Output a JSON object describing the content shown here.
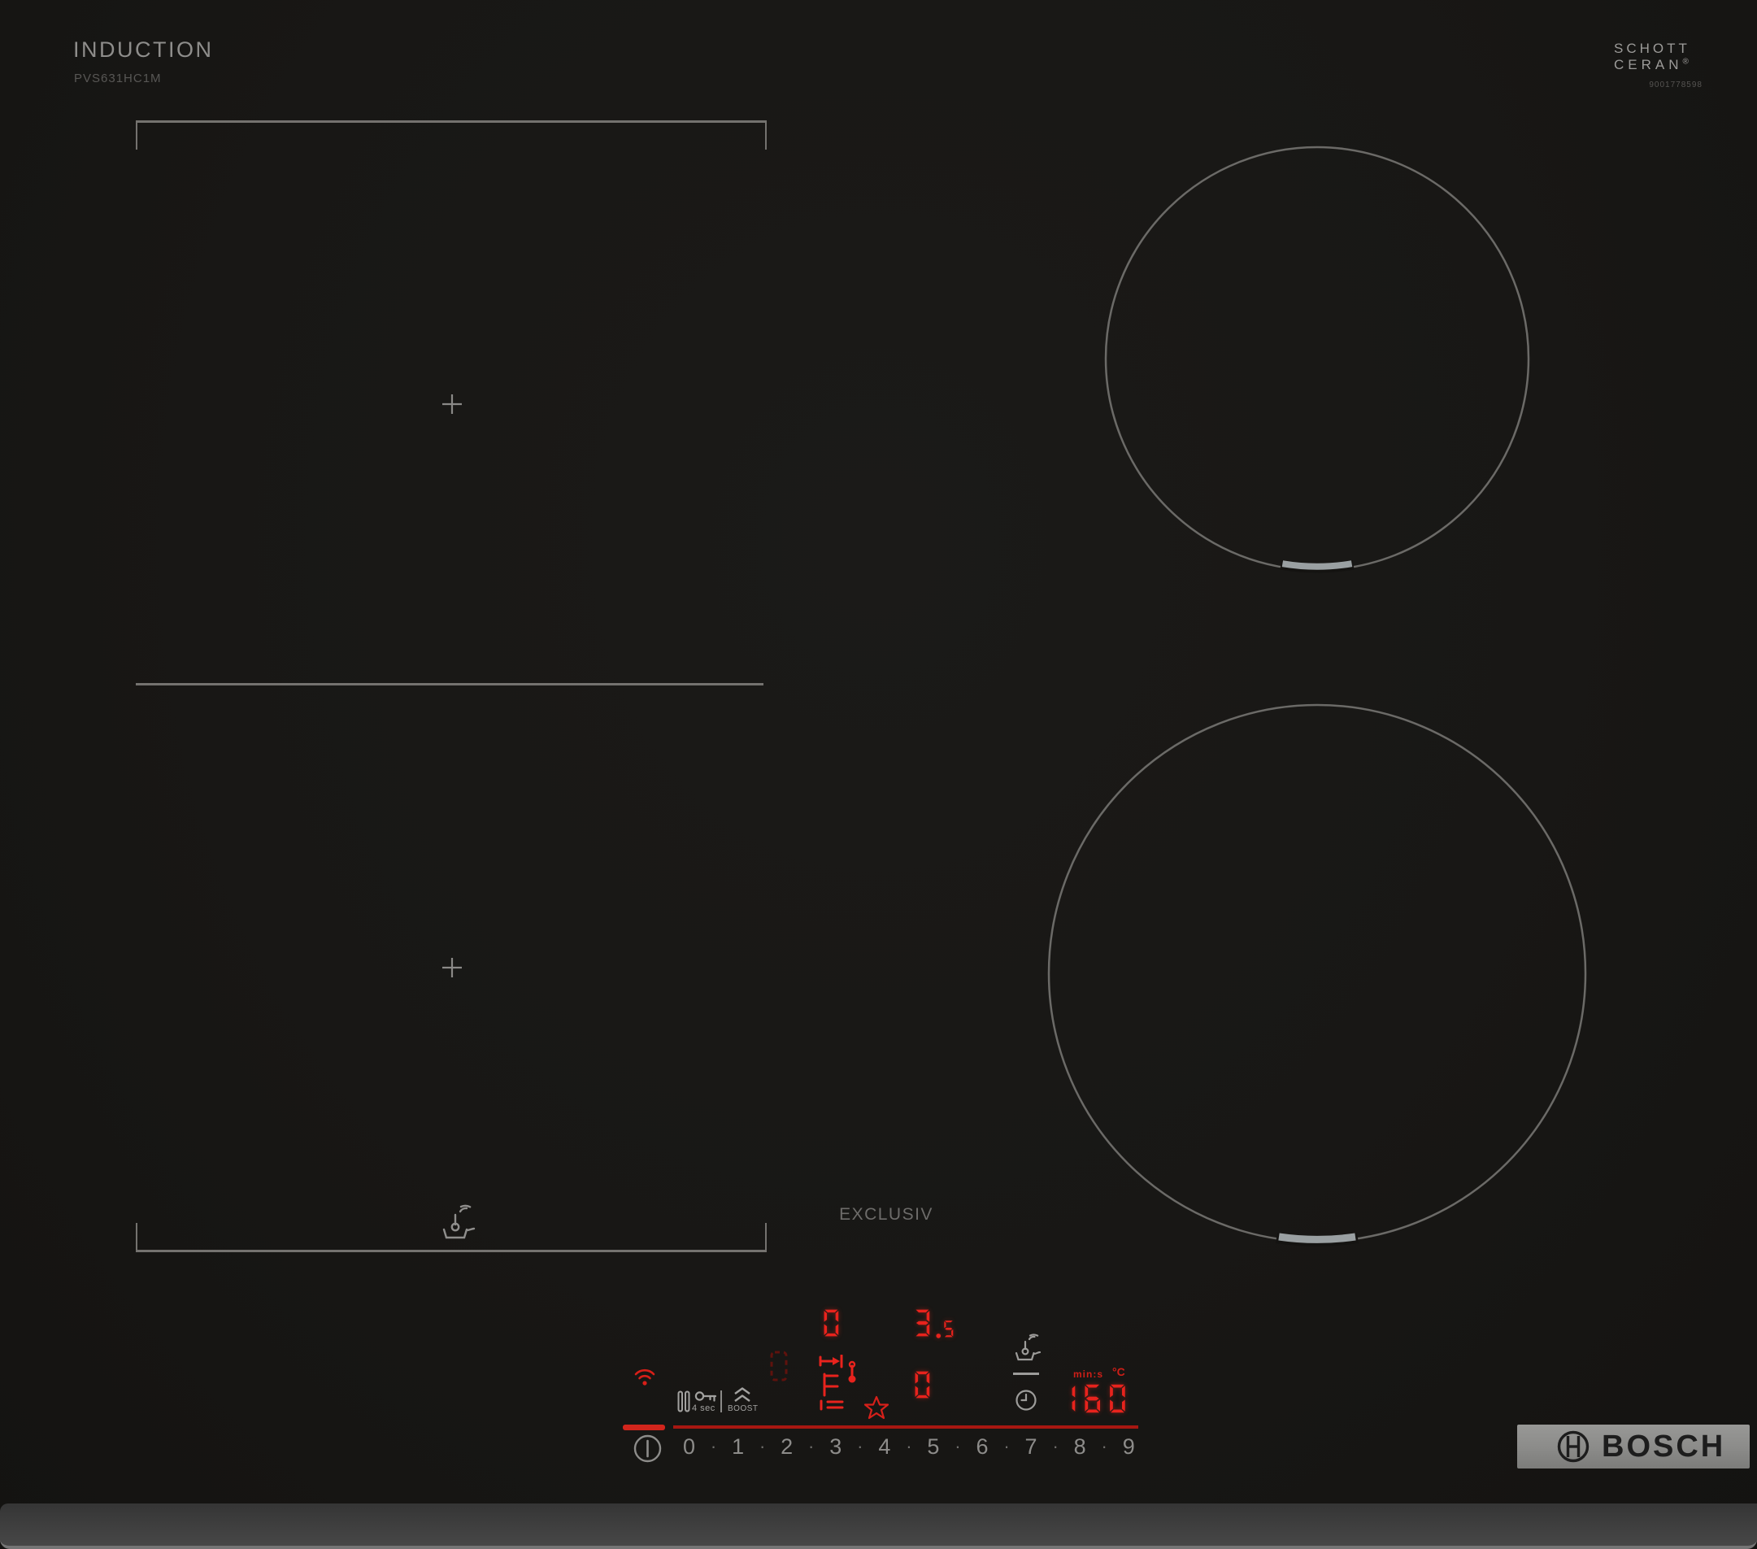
{
  "header": {
    "type_label": "INDUCTION",
    "model": "PVS631HC1M",
    "glass_brand": {
      "line1": "SCHOTT",
      "line2": "CERAN",
      "registered": "®",
      "serial": "9001778598"
    }
  },
  "series_label": "EXCLUSIV",
  "brand": {
    "name": "BOSCH"
  },
  "panel": {
    "lock_hold_label": "4 sec",
    "boost_label": "BOOST",
    "timer_unit_time": "min:s",
    "timer_unit_temp": "°C",
    "keypad": [
      "0",
      "1",
      "2",
      "3",
      "4",
      "5",
      "6",
      "7",
      "8",
      "9"
    ],
    "led": {
      "left_rear_level": "0",
      "left_setting": "3.5",
      "left_front_level": "0",
      "timer": "160"
    }
  },
  "colors": {
    "led_red": "#e8231d",
    "dim_red": "#5f120d",
    "glass_black": "#181715",
    "marking_gray": "#74726f",
    "icon_gray": "#9d9c9a",
    "badge_gray": "#8d8d8b",
    "rail_gray": "#404040"
  }
}
